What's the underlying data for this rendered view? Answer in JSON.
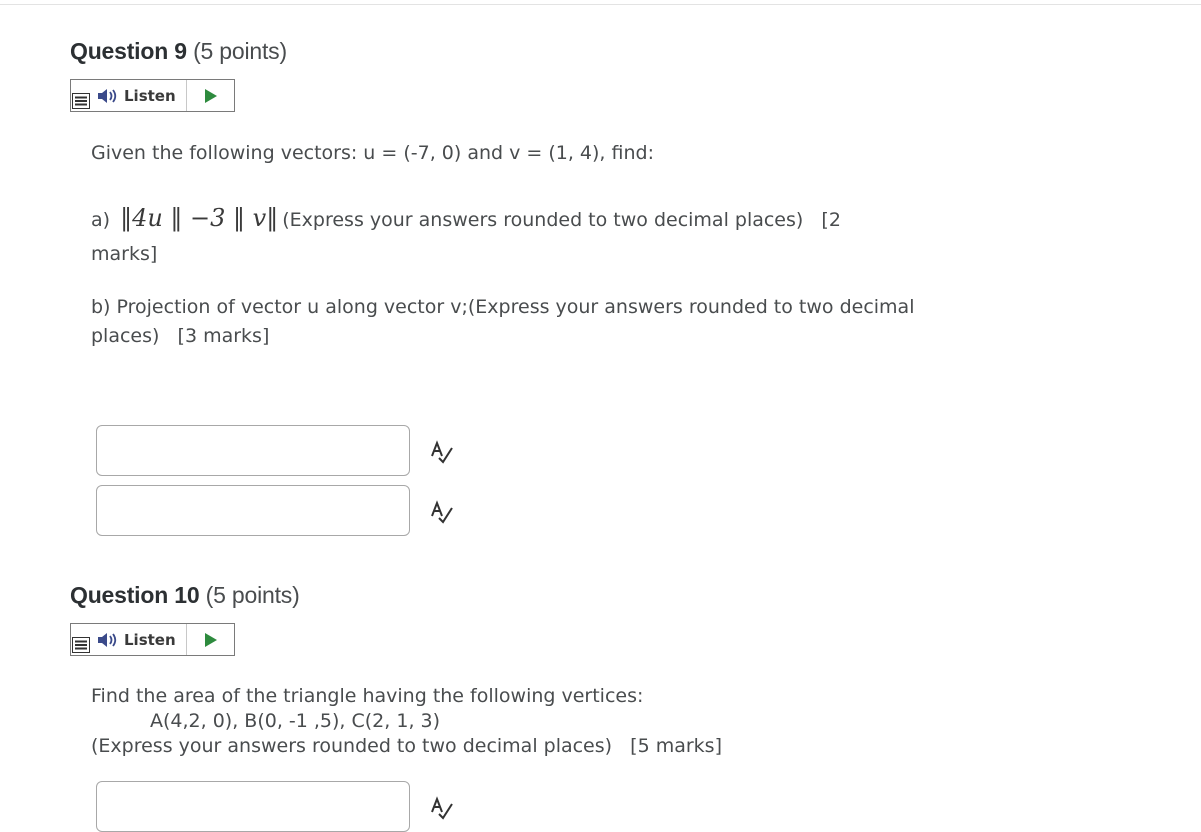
{
  "q9": {
    "number": "Question 9",
    "points": "(5 points)",
    "listen_label": "Listen",
    "intro": "Given the following vectors: u = (-7, 0) and v = (1, 4), find:",
    "part_a_prefix": "a)",
    "part_a_math": "‖4u ‖ −3 ‖ v‖",
    "part_a_instructions": "(Express your answers rounded to two decimal places)   [2",
    "part_a_cont": "marks]",
    "part_b_line1": "b) Projection of vector u along vector v;(Express your answers rounded to two decimal",
    "part_b_line2": "places)   [3 marks]",
    "answers": [
      "",
      ""
    ]
  },
  "q10": {
    "number": "Question 10",
    "points": "(5 points)",
    "listen_label": "Listen",
    "line1": "Find the area of the triangle having the following vertices:",
    "line2": "A(4,2, 0), B(0, -1 ,5), C(2, 1, 3)",
    "line3": "(Express your answers rounded to two decimal places)   [5 marks]",
    "answers": [
      ""
    ]
  },
  "icons": {
    "menu": "hamburger-menu-icon",
    "speaker": "speaker-icon",
    "play": "play-icon",
    "spellcheck": "spellcheck-icon"
  },
  "colors": {
    "play_green": "#2e8b3e",
    "speaker_blue": "#3b4a8a",
    "title": "#2c3033",
    "text": "#494c4e"
  }
}
